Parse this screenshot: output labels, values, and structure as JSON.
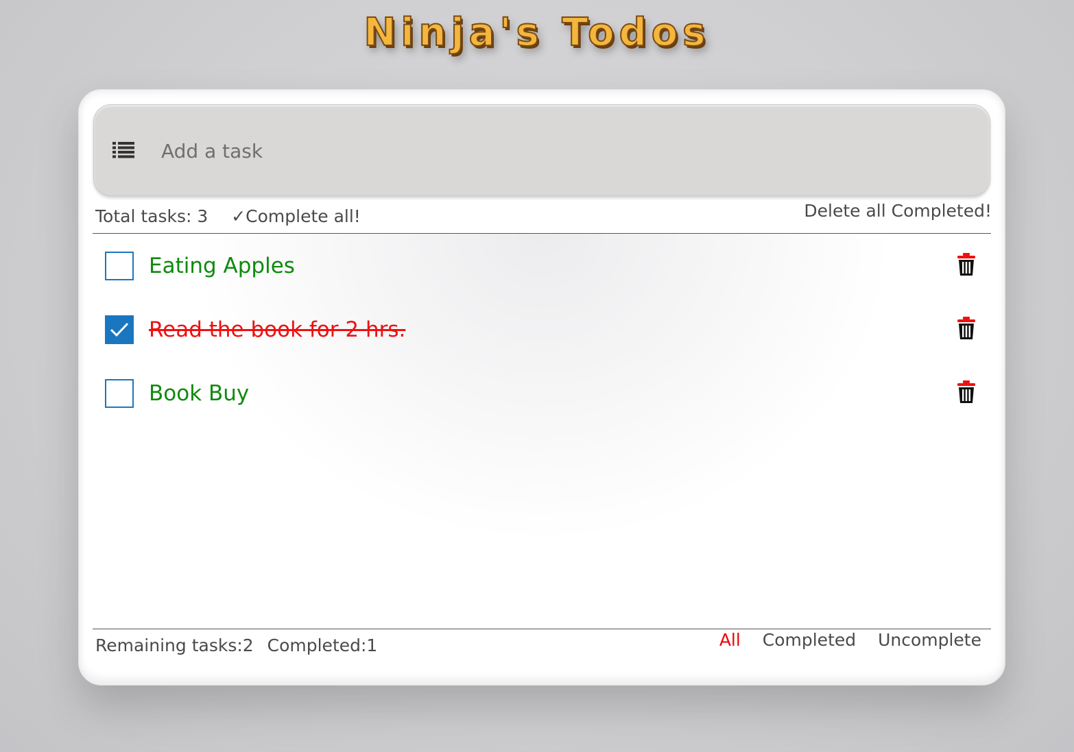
{
  "app": {
    "title": "Ninja's Todos"
  },
  "add_task": {
    "placeholder": "Add a task",
    "icon": "list-icon"
  },
  "toolbar": {
    "total_label": "Total tasks: 3",
    "complete_all_label": "✓Complete all!",
    "delete_completed_label": "Delete all Completed!"
  },
  "tasks": [
    {
      "text": "Eating Apples",
      "completed": false,
      "color": "#0e8a0e"
    },
    {
      "text": "Read the book for 2 hrs.",
      "completed": true,
      "color": "#ee1111"
    },
    {
      "text": "Book Buy",
      "completed": false,
      "color": "#0e8a0e"
    }
  ],
  "footer": {
    "remaining_label": "Remaining tasks:2",
    "completed_label": "Completed:1",
    "filters": [
      {
        "label": "All",
        "active": true
      },
      {
        "label": "Completed",
        "active": false
      },
      {
        "label": "Uncomplete",
        "active": false
      }
    ]
  },
  "colors": {
    "checkbox_blue": "#1b76c0",
    "active_filter": "#ee0000",
    "trash_lid": "#ee1111",
    "title_gold": "#f4b63d"
  }
}
